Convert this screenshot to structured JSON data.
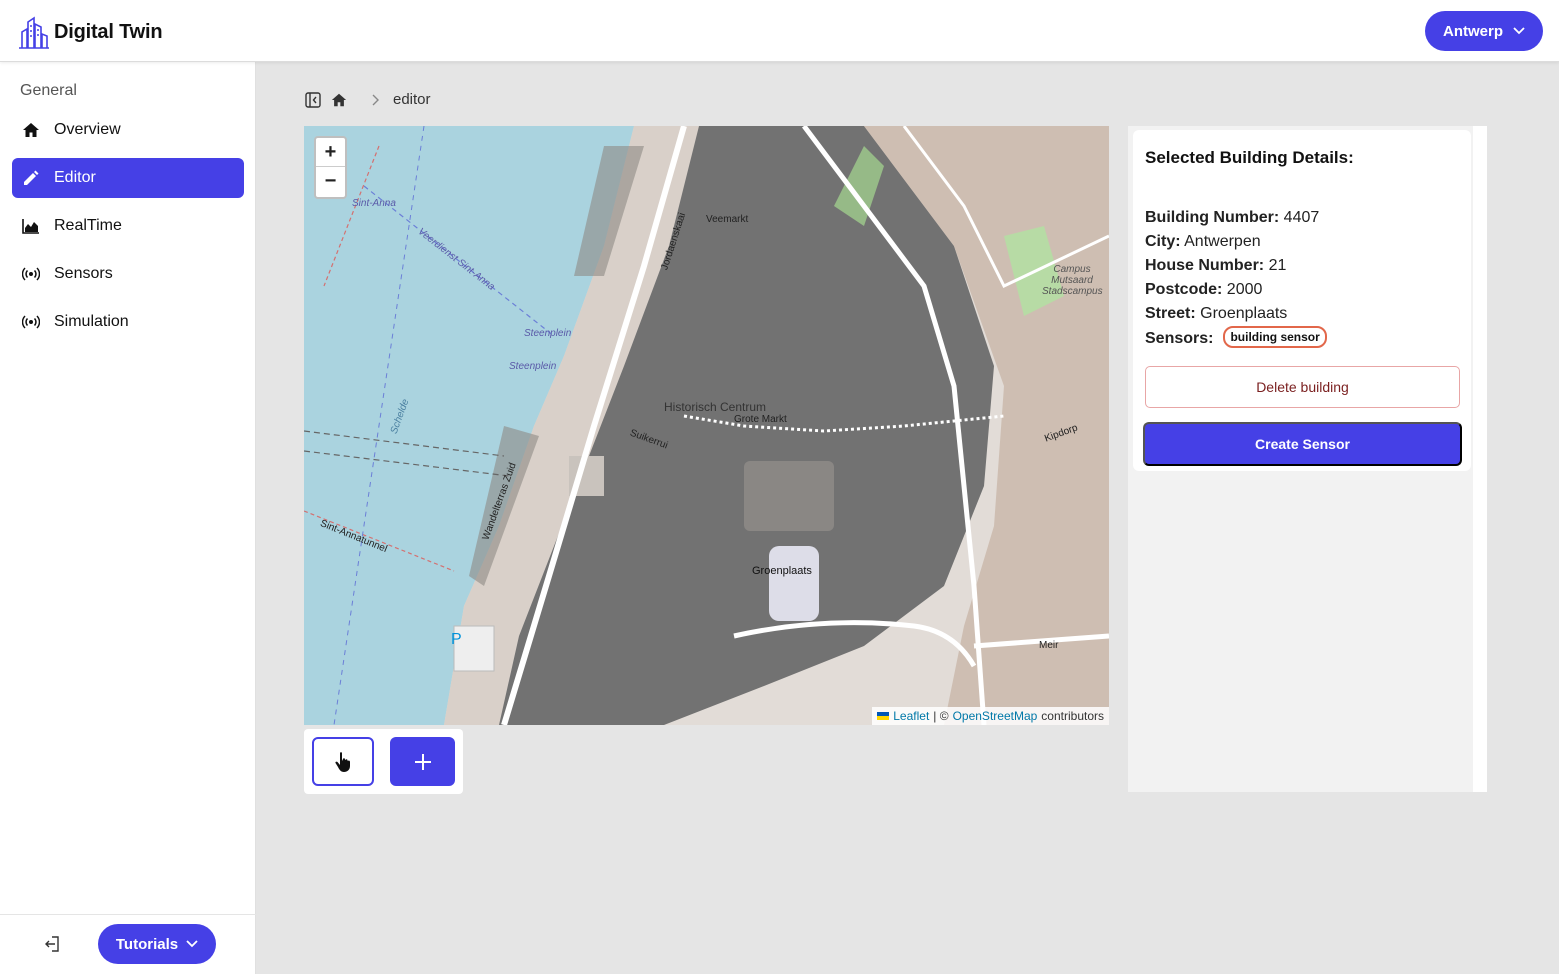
{
  "app": {
    "title": "Digital Twin"
  },
  "header": {
    "city_selector": {
      "label": "Antwerp",
      "icon": "chevron-down-icon"
    }
  },
  "sidebar": {
    "heading": "General",
    "items": [
      {
        "label": "Overview",
        "icon": "home-icon",
        "active": false
      },
      {
        "label": "Editor",
        "icon": "pencil-icon",
        "active": true
      },
      {
        "label": "RealTime",
        "icon": "area-chart-icon",
        "active": false
      },
      {
        "label": "Sensors",
        "icon": "broadcast-icon",
        "active": false
      },
      {
        "label": "Simulation",
        "icon": "broadcast-icon",
        "active": false
      }
    ],
    "footer": {
      "logout_icon": "logout-icon",
      "tutorials_label": "Tutorials"
    }
  },
  "breadcrumb": {
    "current": "editor"
  },
  "map": {
    "zoom_in": "+",
    "zoom_out": "−",
    "attribution": {
      "leaflet": "Leaflet",
      "separator": "| ©",
      "osm": "OpenStreetMap",
      "suffix": "contributors"
    },
    "labels": {
      "sint_anna": "Sint-Anna",
      "veerdienst": "Veerdienst Sint-Anna",
      "steenplein1": "Steenplein",
      "steenplein2": "Steenplein",
      "schelde": "Schelde",
      "historisch": "Historisch Centrum",
      "grote_markt": "Grote Markt",
      "groenplaats": "Groenplaats",
      "meir": "Meir",
      "campus": "Campus Mutsaard Stadscampus",
      "kipdorp": "Kipdorp",
      "veemarkt": "Veemarkt",
      "suikerrui": "Suikerrui",
      "jordaenskaai": "Jordaenskaai",
      "sint_annatunnel": "Sint-Annatunnel",
      "wandelterras": "Wandelterras Zuid",
      "parking": "P"
    }
  },
  "tools": {
    "select_icon": "hand-pointer-icon",
    "add_icon": "plus-icon"
  },
  "details": {
    "title": "Selected Building Details:",
    "fields": {
      "building_number": {
        "key": "Building Number:",
        "value": "4407"
      },
      "city": {
        "key": "City:",
        "value": "Antwerpen"
      },
      "house_number": {
        "key": "House Number:",
        "value": "21"
      },
      "postcode": {
        "key": "Postcode:",
        "value": "2000"
      },
      "street": {
        "key": "Street:",
        "value": "Groenplaats"
      },
      "sensors": {
        "key": "Sensors:",
        "badge": "building sensor"
      }
    },
    "delete_label": "Delete building",
    "create_label": "Create Sensor"
  },
  "colors": {
    "accent": "#4540e6",
    "water": "#aad3df",
    "building": "#727272",
    "danger_border": "#e8a6a6",
    "badge_border": "#e2674a"
  }
}
